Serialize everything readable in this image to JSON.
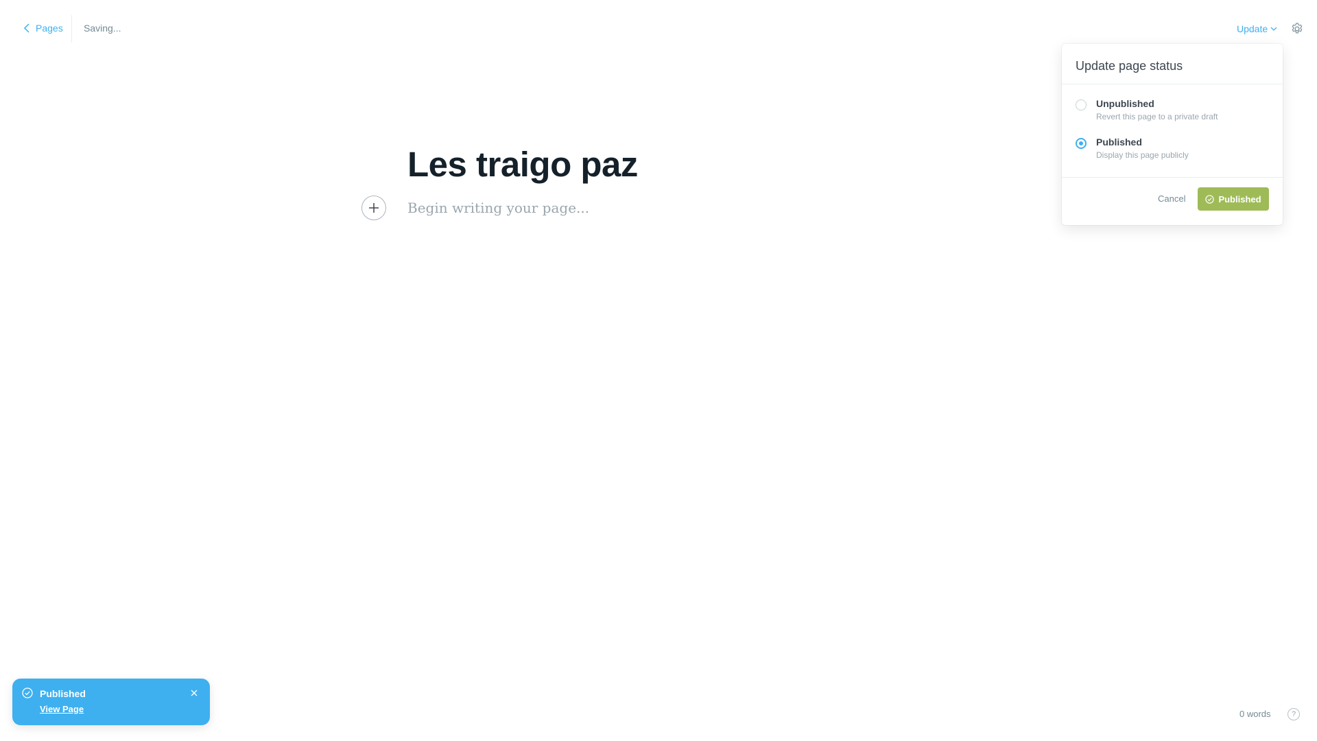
{
  "header": {
    "back_label": "Pages",
    "status_text": "Saving...",
    "update_label": "Update"
  },
  "editor": {
    "title": "Les traigo paz",
    "placeholder": "Begin writing your page..."
  },
  "popup": {
    "title": "Update page status",
    "options": [
      {
        "label": "Unpublished",
        "description": "Revert this page to a private draft",
        "selected": false
      },
      {
        "label": "Published",
        "description": "Display this page publicly",
        "selected": true
      }
    ],
    "cancel_label": "Cancel",
    "confirm_label": "Published"
  },
  "toast": {
    "title": "Published",
    "link_label": "View Page"
  },
  "footer": {
    "word_count": "0 words",
    "help_label": "?"
  },
  "colors": {
    "accent": "#3eb0ef",
    "success": "#9fbb58",
    "text": "#15212a",
    "muted": "#738a94"
  },
  "icons": [
    "chevron-left-icon",
    "chevron-down-icon",
    "gear-icon",
    "plus-icon",
    "check-circle-icon",
    "close-icon",
    "help-icon"
  ]
}
